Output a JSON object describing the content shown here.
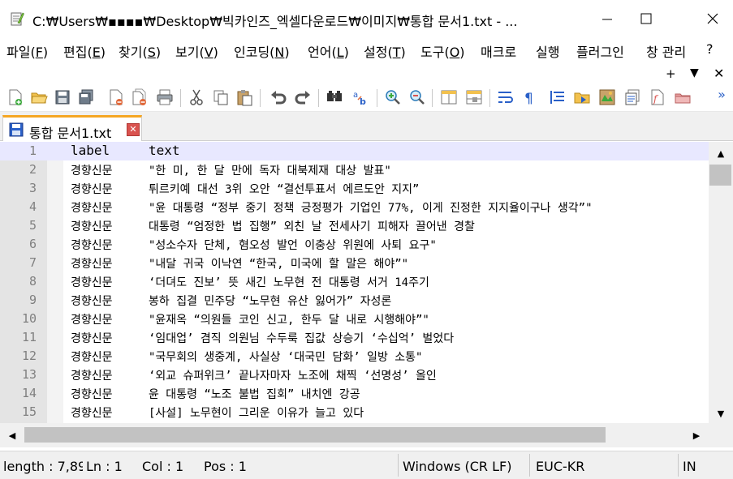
{
  "window": {
    "title": "C:₩Users₩▪▪▪▪₩Desktop₩빅카인즈_엑셀다운로드₩이미지₩통합 문서1.txt - ...",
    "min_symbol": "—",
    "max_symbol": "☐",
    "close_symbol": "✕"
  },
  "menu": {
    "items": [
      {
        "label": "파일(",
        "key": "F",
        "end": ")"
      },
      {
        "label": "편집(",
        "key": "E",
        "end": ")"
      },
      {
        "label": "찾기(",
        "key": "S",
        "end": ")"
      },
      {
        "label": "보기(",
        "key": "V",
        "end": ")"
      },
      {
        "label": "인코딩(",
        "key": "N",
        "end": ")"
      },
      {
        "label": "언어(",
        "key": "L",
        "end": ")"
      },
      {
        "label": "설정(",
        "key": "T",
        "end": ")"
      },
      {
        "label": "도구(",
        "key": "O",
        "end": ")"
      },
      {
        "label": "매크로",
        "key": "",
        "end": ""
      },
      {
        "label": "실행",
        "key": "",
        "end": ""
      },
      {
        "label": "플러그인",
        "key": "",
        "end": ""
      },
      {
        "label": "창 관리",
        "key": "",
        "end": ""
      },
      {
        "label": "?",
        "key": "",
        "end": ""
      }
    ],
    "extra_plus": "+",
    "extra_down": "▼",
    "extra_close": "✕"
  },
  "toolbar": {
    "overflow": "»",
    "icons": [
      "new-file-icon",
      "open-file-icon",
      "save-icon",
      "save-all-icon",
      "close-icon",
      "close-all-icon",
      "print-icon",
      "cut-icon",
      "copy-icon",
      "paste-icon",
      "undo-icon",
      "redo-icon",
      "find-icon",
      "replace-icon",
      "zoom-in-icon",
      "zoom-out-icon",
      "sync-vertical-icon",
      "sync-horizontal-icon",
      "word-wrap-icon",
      "show-all-chars-icon",
      "indent-guide-icon",
      "folder-as-workspace-icon",
      "document-map-icon",
      "function-list-icon",
      "macro-record-icon",
      "macro-stop-icon"
    ]
  },
  "tab": {
    "label": "통합 문서1.txt",
    "close_symbol": "✕"
  },
  "editor": {
    "lines": [
      {
        "num": "1",
        "label": "label",
        "text": "text"
      },
      {
        "num": "2",
        "label": "경향신문",
        "text": "\"한 미, 한 달 만에 독자 대북제재 대상 발표\""
      },
      {
        "num": "3",
        "label": "경향신문",
        "text": "튀르키예 대선 3위 오안 “결선투표서 에르도안 지지”"
      },
      {
        "num": "4",
        "label": "경향신문",
        "text": "\"윤 대통령 “정부 중기 정책 긍정평가 기업인 77%, 이게 진정한 지지율이구나 생각”\""
      },
      {
        "num": "5",
        "label": "경향신문",
        "text": "대통령 “엄정한 법 집행” 외친 날 전세사기 피해자 끌어낸 경찰"
      },
      {
        "num": "6",
        "label": "경향신문",
        "text": "\"성소수자 단체, 혐오성 발언 이충상 위원에 사퇴 요구\""
      },
      {
        "num": "7",
        "label": "경향신문",
        "text": "\"내달 귀국 이낙연 “한국, 미국에 할 말은 해야”\""
      },
      {
        "num": "8",
        "label": "경향신문",
        "text": "‘더뎌도 진보’ 뜻 새긴 노무현 전 대통령 서거 14주기"
      },
      {
        "num": "9",
        "label": "경향신문",
        "text": "봉하 집결 민주당 “노무현 유산 잃어가” 자성론"
      },
      {
        "num": "10",
        "label": "경향신문",
        "text": "\"윤재옥 “의원들 코인 신고, 한두 달 내로 시행해야”\""
      },
      {
        "num": "11",
        "label": "경향신문",
        "text": "‘임대업’ 겸직 의원님 수두룩 집값 상승기 ‘수십억’ 벌었다"
      },
      {
        "num": "12",
        "label": "경향신문",
        "text": "\"국무회의 생중계, 사실상 ‘대국민 담화’ 일방 소통\""
      },
      {
        "num": "13",
        "label": "경향신문",
        "text": "‘외교 슈퍼위크’ 끝나자마자 노조에 채찍 ‘선명성’ 올인"
      },
      {
        "num": "14",
        "label": "경향신문",
        "text": "윤 대통령 “노조 불법 집회” 내치엔 강공"
      },
      {
        "num": "15",
        "label": "경향신문",
        "text": "[사설] 노무현이 그리운 이유가 늘고 있다"
      }
    ]
  },
  "scroll": {
    "up": "▲",
    "down": "▼",
    "left": "◀",
    "right": "▶"
  },
  "status": {
    "length": "length : 7,89",
    "ln": "Ln : 1",
    "col": "Col : 1",
    "pos": "Pos : 1",
    "eol": "Windows (CR LF)",
    "encoding": "EUC-KR",
    "mode": "IN"
  }
}
